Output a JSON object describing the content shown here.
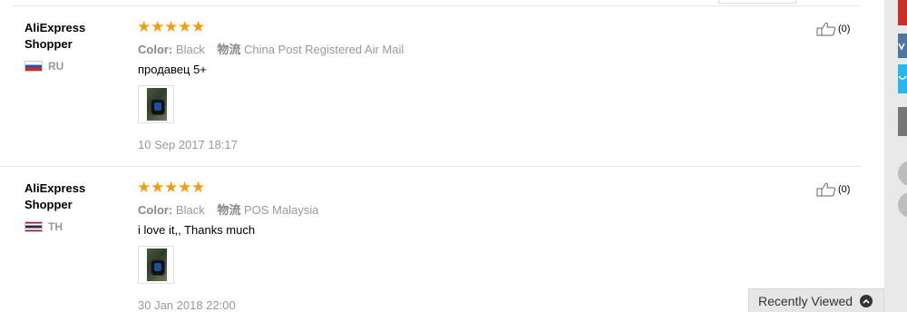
{
  "reviews": [
    {
      "user": "AliExpress Shopper",
      "country": "RU",
      "stars": 5,
      "color_label": "Color:",
      "color_value": "Black",
      "shipping_label": "物流",
      "shipping_value": "China Post Registered Air Mail",
      "text": "продавец 5+",
      "date": "10 Sep 2017 18:17",
      "helpful_count": "(0)"
    },
    {
      "user": "AliExpress Shopper",
      "country": "TH",
      "stars": 5,
      "color_label": "Color:",
      "color_value": "Black",
      "shipping_label": "物流",
      "shipping_value": "POS Malaysia",
      "text": "i love it,, Thanks much",
      "date": "30 Jan 2018 22:00",
      "helpful_count": "(0)"
    }
  ],
  "recently_viewed": {
    "label": "Recently Viewed"
  },
  "colors": {
    "star": "#f39c12",
    "vk": "#4e76a1",
    "twitter": "#2bb5ea",
    "share_red": "#c9302c"
  },
  "icons": [
    "thumbs-up-icon",
    "flag-ru-icon",
    "flag-th-icon",
    "chevron-up-icon",
    "vk-icon",
    "twitter-icon"
  ]
}
